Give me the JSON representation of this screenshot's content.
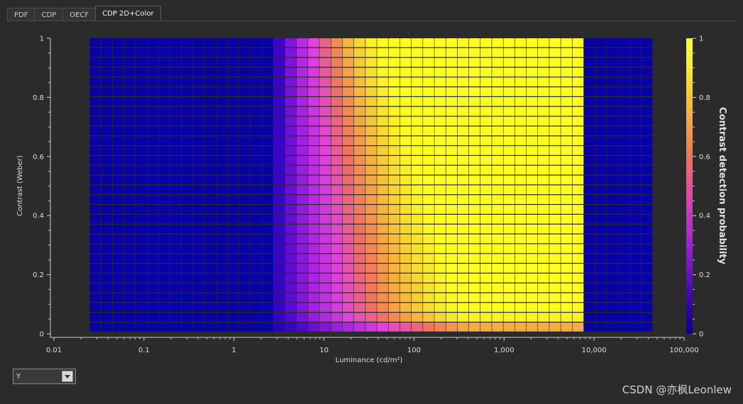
{
  "tabs": [
    {
      "label": "PDF",
      "active": false
    },
    {
      "label": "CDP",
      "active": false
    },
    {
      "label": "OECF",
      "active": false
    },
    {
      "label": "CDP 2D+Color",
      "active": true
    }
  ],
  "selector": {
    "value": "Y"
  },
  "watermark": "CSDN @亦枫Leonlew",
  "chart_data": {
    "type": "heatmap",
    "xlabel": "Luminance (cd/m²)",
    "ylabel": "Contrast (Weber)",
    "colorbar_label": "Contrast detection probability",
    "x_scale": "log",
    "xlim": [
      0.01,
      100000
    ],
    "ylim": [
      0,
      1
    ],
    "x_ticks": [
      "0.01",
      "0.1",
      "1",
      "10",
      "100",
      "1,000",
      "10,000",
      "100,000"
    ],
    "y_ticks": [
      "0",
      "0.2",
      "0.4",
      "0.6",
      "0.8",
      "1"
    ],
    "colorbar_ticks": [
      "0",
      "0.2",
      "0.4",
      "0.6",
      "0.8",
      "1"
    ],
    "colorbar_range": [
      0,
      1
    ],
    "data_x_range": [
      0.025,
      45000
    ],
    "data_y_range": [
      0.005,
      1
    ],
    "colormap": [
      "#0000a0",
      "#3c04c8",
      "#a020e0",
      "#e040e0",
      "#f07060",
      "#f5b040",
      "#f8e030",
      "#ffff20"
    ],
    "grid_cols": 49,
    "grid_rows": 30,
    "description_regions": {
      "low_luminance_cutoff": 3,
      "rise_end_at_top": 40,
      "rise_end_at_bottom": 400,
      "high_luminance_cutoff": 8000
    }
  }
}
